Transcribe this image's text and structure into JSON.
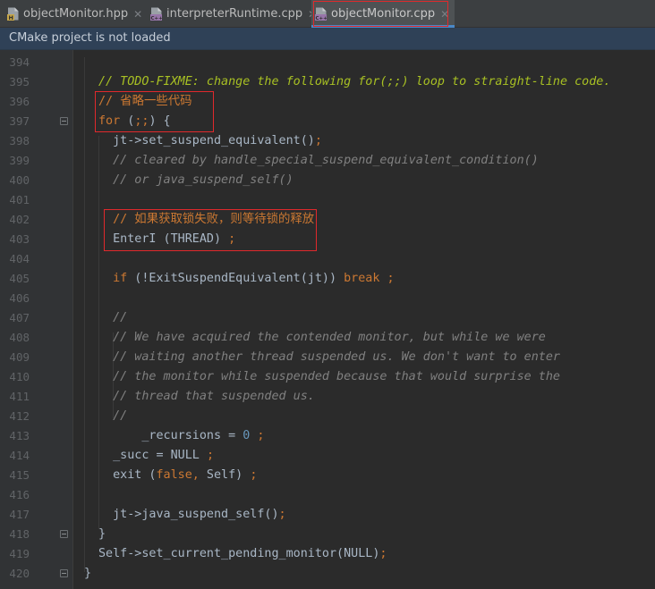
{
  "tabs": [
    {
      "label": "objectMonitor.hpp",
      "icon": "hpp-file-icon",
      "active": false
    },
    {
      "label": "interpreterRuntime.cpp",
      "icon": "cpp-file-icon",
      "active": false
    },
    {
      "label": "objectMonitor.cpp",
      "icon": "cpp-file-icon",
      "active": true
    }
  ],
  "tab_close_glyph": "✕",
  "notice": {
    "text": "CMake project is not loaded"
  },
  "colors": {
    "highlight_box": "#e0292c",
    "keyword": "#cc7832",
    "todo": "#a8c023",
    "comment": "#808080",
    "number": "#6897bb",
    "default_text": "#a9b7c6"
  },
  "editor": {
    "lines": [
      {
        "num": "394",
        "tokens": []
      },
      {
        "num": "395",
        "tokens": [
          {
            "t": "// TODO-FIXME: change the following for(;;) loop to straight-line code.",
            "c": "todo"
          }
        ]
      },
      {
        "num": "396",
        "tokens": [
          {
            "t": "// 省略一些代码",
            "c": "cn"
          }
        ]
      },
      {
        "num": "397",
        "tokens": [
          {
            "t": "for",
            "c": "kw"
          },
          {
            "t": " (",
            "c": "plain"
          },
          {
            "t": ";;",
            "c": "kw"
          },
          {
            "t": ") {",
            "c": "plain"
          }
        ]
      },
      {
        "num": "398",
        "tokens": [
          {
            "t": "  jt->set_suspend_equivalent()",
            "c": "plain"
          },
          {
            "t": ";",
            "c": "kw"
          }
        ]
      },
      {
        "num": "399",
        "tokens": [
          {
            "t": "  // cleared by handle_special_suspend_equivalent_condition()",
            "c": "comment"
          }
        ]
      },
      {
        "num": "400",
        "tokens": [
          {
            "t": "  // or java_suspend_self()",
            "c": "comment"
          }
        ]
      },
      {
        "num": "401",
        "tokens": []
      },
      {
        "num": "402",
        "tokens": [
          {
            "t": "  // 如果获取锁失败，则等待锁的释放",
            "c": "cn"
          }
        ]
      },
      {
        "num": "403",
        "tokens": [
          {
            "t": "  EnterI (THREAD) ",
            "c": "plain"
          },
          {
            "t": ";",
            "c": "kw"
          }
        ]
      },
      {
        "num": "404",
        "tokens": []
      },
      {
        "num": "405",
        "tokens": [
          {
            "t": "  ",
            "c": "plain"
          },
          {
            "t": "if",
            "c": "kw"
          },
          {
            "t": " (!ExitSuspendEquivalent(jt)) ",
            "c": "plain"
          },
          {
            "t": "break",
            "c": "kw"
          },
          {
            "t": " ",
            "c": "plain"
          },
          {
            "t": ";",
            "c": "kw"
          }
        ]
      },
      {
        "num": "406",
        "tokens": []
      },
      {
        "num": "407",
        "tokens": [
          {
            "t": "  //",
            "c": "comment"
          }
        ]
      },
      {
        "num": "408",
        "tokens": [
          {
            "t": "  // We have acquired the contended monitor, but while we were",
            "c": "comment"
          }
        ]
      },
      {
        "num": "409",
        "tokens": [
          {
            "t": "  // waiting another thread suspended us. We don't want to enter",
            "c": "comment"
          }
        ]
      },
      {
        "num": "410",
        "tokens": [
          {
            "t": "  // the monitor while suspended because that would surprise the",
            "c": "comment"
          }
        ]
      },
      {
        "num": "411",
        "tokens": [
          {
            "t": "  // thread that suspended us.",
            "c": "comment"
          }
        ]
      },
      {
        "num": "412",
        "tokens": [
          {
            "t": "  //",
            "c": "comment"
          }
        ]
      },
      {
        "num": "413",
        "tokens": [
          {
            "t": "      _recursions = ",
            "c": "plain"
          },
          {
            "t": "0",
            "c": "num"
          },
          {
            "t": " ",
            "c": "plain"
          },
          {
            "t": ";",
            "c": "kw"
          }
        ]
      },
      {
        "num": "414",
        "tokens": [
          {
            "t": "  _succ = NULL ",
            "c": "plain"
          },
          {
            "t": ";",
            "c": "kw"
          }
        ]
      },
      {
        "num": "415",
        "tokens": [
          {
            "t": "  exit (",
            "c": "plain"
          },
          {
            "t": "false,",
            "c": "kw"
          },
          {
            "t": " Self) ",
            "c": "plain"
          },
          {
            "t": ";",
            "c": "kw"
          }
        ]
      },
      {
        "num": "416",
        "tokens": []
      },
      {
        "num": "417",
        "tokens": [
          {
            "t": "  jt->java_suspend_self()",
            "c": "plain"
          },
          {
            "t": ";",
            "c": "kw"
          }
        ]
      },
      {
        "num": "418",
        "tokens": [
          {
            "t": "}",
            "c": "plain"
          }
        ]
      },
      {
        "num": "419",
        "tokens": [
          {
            "t": "Self->set_current_pending_monitor(NULL)",
            "c": "plain"
          },
          {
            "t": ";",
            "c": "kw"
          }
        ]
      },
      {
        "num": "420",
        "tokens": [
          {
            "t": "}",
            "c": "plain"
          }
        ]
      }
    ]
  }
}
